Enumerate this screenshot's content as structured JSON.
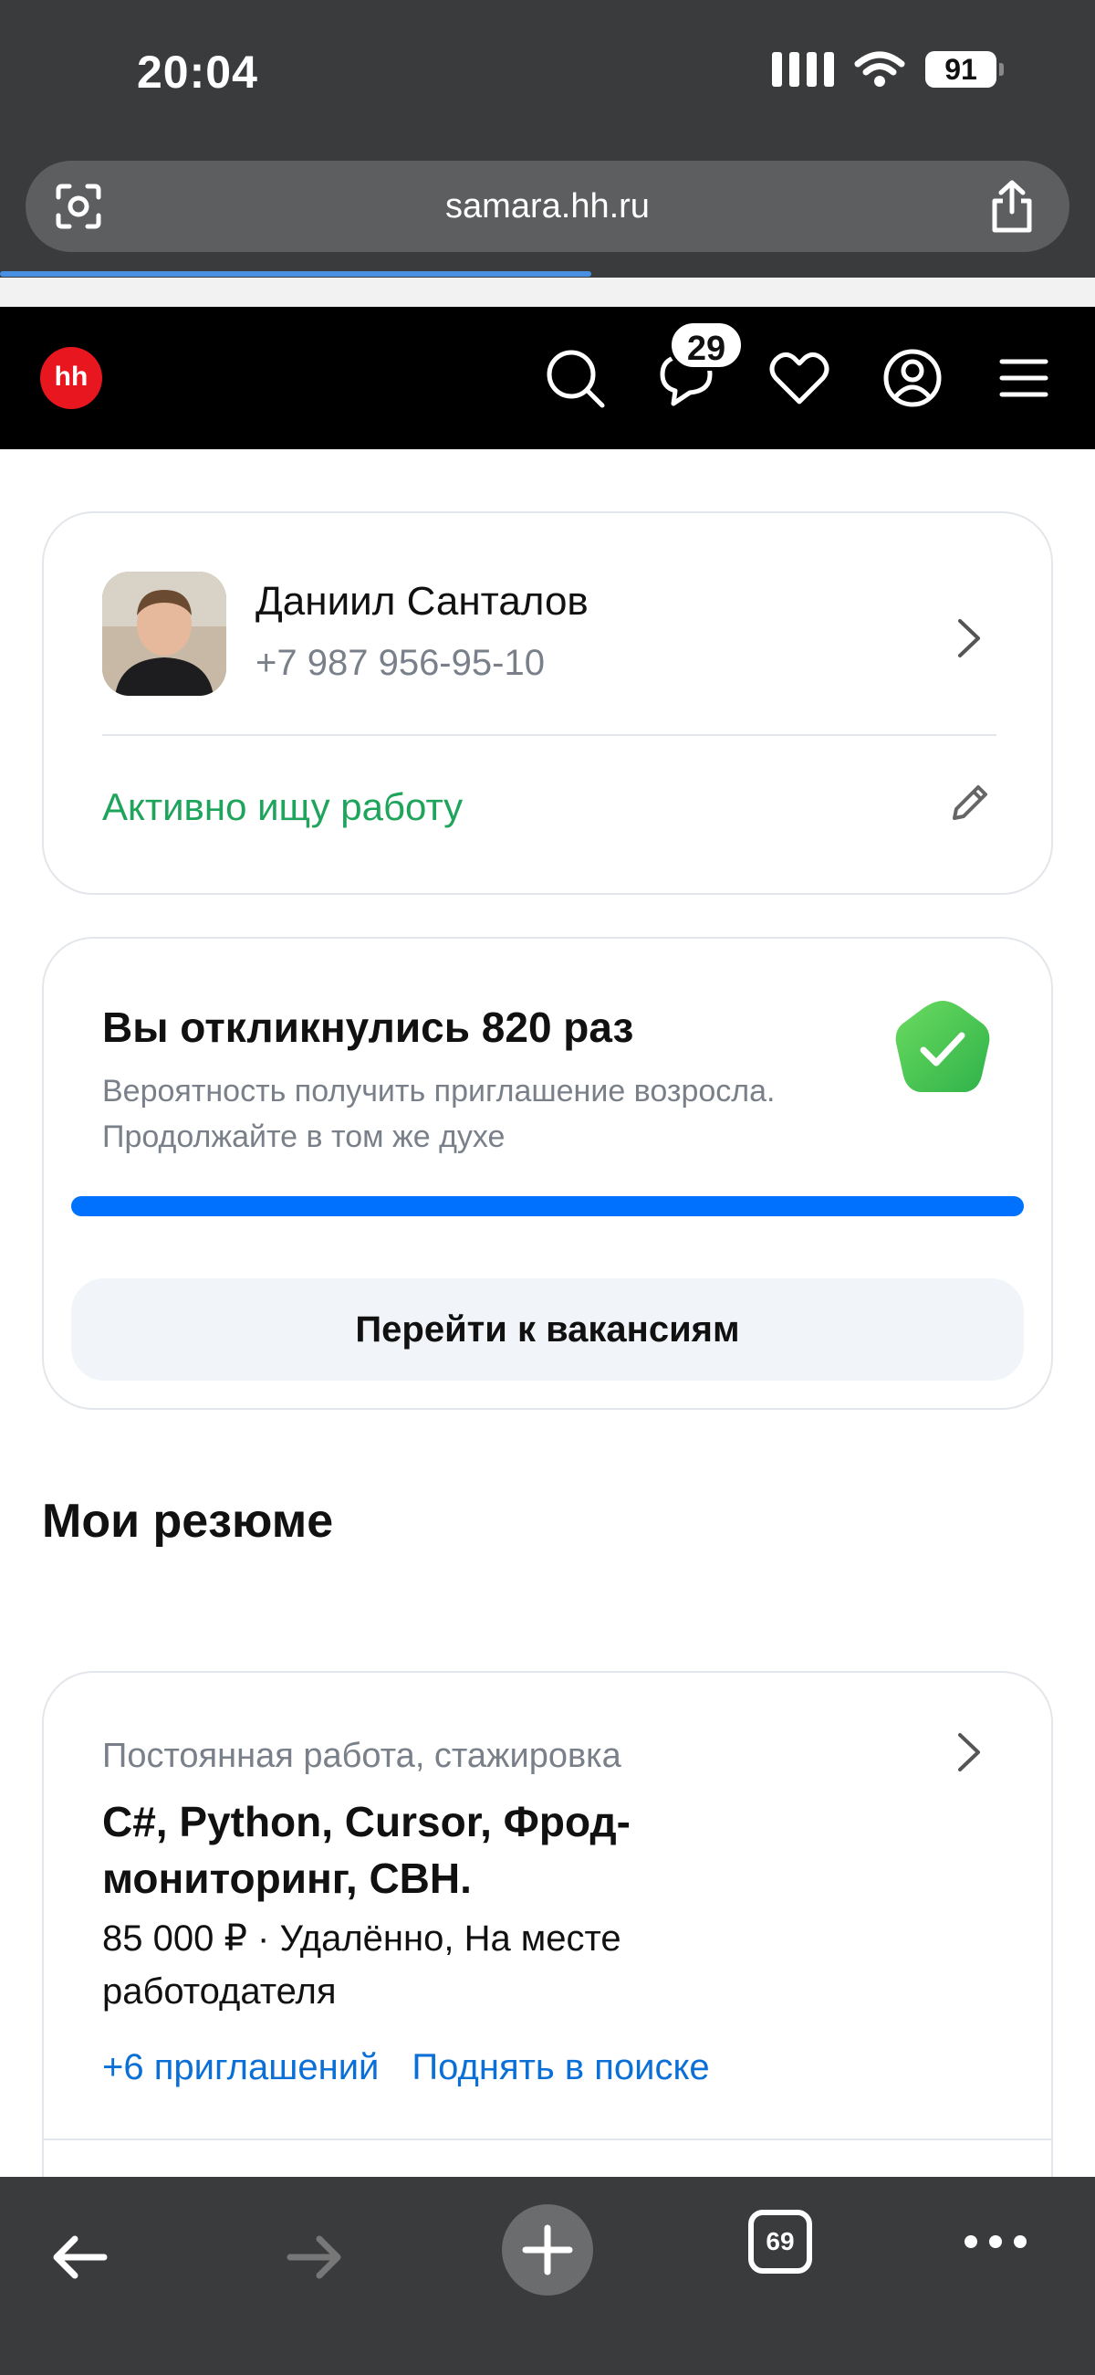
{
  "status_bar": {
    "time": "20:04",
    "battery": "91"
  },
  "browser": {
    "url": "samara.hh.ru",
    "load_progress": 0.54,
    "tabs_count": "69"
  },
  "header": {
    "logo": "hh",
    "messages_badge": "29",
    "icons": [
      "search-icon",
      "chat-icon",
      "heart-icon",
      "profile-icon",
      "menu-icon"
    ]
  },
  "profile": {
    "name": "Даниил Санталов",
    "phone": "+7 987 956-95-10",
    "status": "Активно ищу работу",
    "status_color": "#1fa45c"
  },
  "responses": {
    "title": "Вы откликнулись 820 раз",
    "subtitle": "Вероятность получить приглашение возросла. Продолжайте в том же духе",
    "progress": 1.0,
    "button": "Перейти к вакансиям",
    "accent": "#0070ff"
  },
  "resumes": {
    "section_title": "Мои резюме",
    "items": [
      {
        "type": "Постоянная работа, стажировка",
        "title": "C#, Python, Cursor, Фрод-мониторинг, СВН.",
        "meta": "85 000 ₽ · Удалённо, На месте работодателя",
        "invitations": "+6 приглашений",
        "boost": "Поднять в поиске"
      }
    ]
  }
}
